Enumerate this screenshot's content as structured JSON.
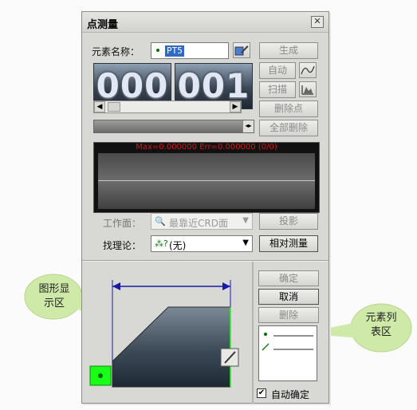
{
  "dialog": {
    "title": "点测量",
    "close_glyph": "✕",
    "element_name_label": "元素名称：",
    "element_name_value": "PT5",
    "counter_left": "000",
    "counter_right": "001",
    "plot_label": "Max=0.000000 Err=0.000000 (0/0)",
    "workplane_label": "工作面：",
    "workplane_value": "最靠近CRD面",
    "theory_label": "找理论：",
    "theory_value": "(无)",
    "buttons": {
      "generate": "生成",
      "auto": "自动",
      "scan": "扫描",
      "delete_point": "删除点",
      "delete_all": "全部删除",
      "project": "投影",
      "relative": "相对测量",
      "ok": "确定",
      "cancel": "取消",
      "delete": "删除"
    },
    "auto_confirm_label": "自动确定",
    "auto_confirm_checked": true
  },
  "callouts": {
    "graphics_area_label": "图形显\n示区",
    "element_list_label": "元素列\n表区"
  },
  "colors": {
    "dialog_bg": "#d8d8d4",
    "plot_text": "#d01818",
    "dimension_line": "#1a1aa8",
    "selection_green": "#19ff19",
    "callout_fill": "#cfe9a8"
  }
}
